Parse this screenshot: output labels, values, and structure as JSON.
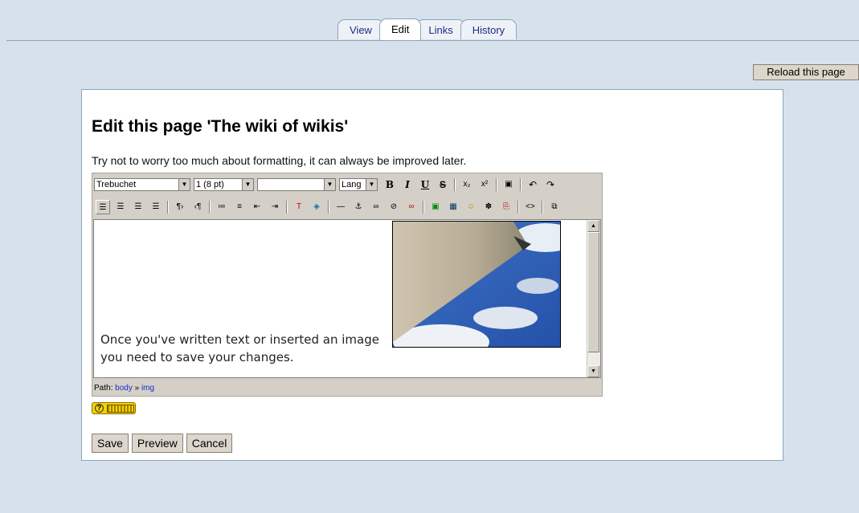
{
  "tabs": [
    "View",
    "Edit",
    "Links",
    "History"
  ],
  "active_tab": "Edit",
  "reload_label": "Reload this page",
  "page_title": "Edit this page 'The wiki of wikis'",
  "intro": "Try not to worry too much about formatting, it can always be improved later.",
  "toolbar": {
    "font": "Trebuchet",
    "size": "1 (8 pt)",
    "format": "",
    "lang": "Lang",
    "bold": "B",
    "italic": "I",
    "underline": "U",
    "strike": "S"
  },
  "editor": {
    "line1": "Once you've written text or inserted an image",
    "line2": "you need to save your changes."
  },
  "path": {
    "label": "Path:",
    "body": "body",
    "sep": "»",
    "img": "img"
  },
  "buttons": {
    "save": "Save",
    "preview": "Preview",
    "cancel": "Cancel"
  },
  "colors": {
    "page_bg": "#d6e1ec",
    "panel_border": "#8ea4bc",
    "toolbar_bg": "#d4d0c8",
    "button_bg": "#ddd6cc"
  }
}
